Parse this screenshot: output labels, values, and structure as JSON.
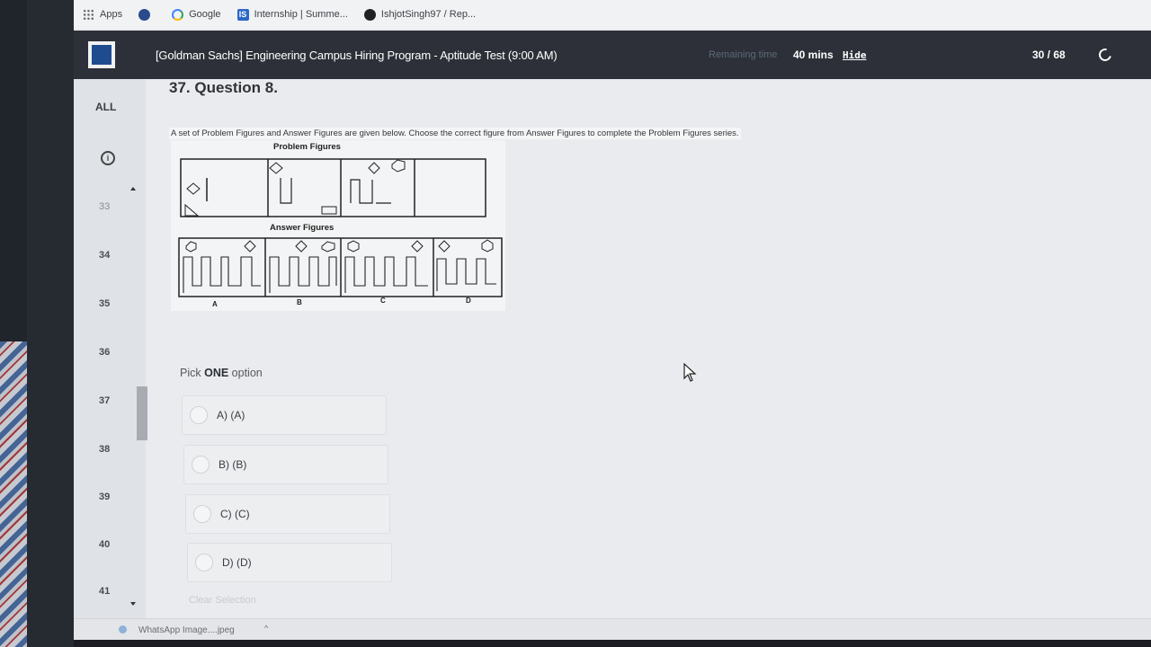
{
  "bookmarks": [
    {
      "label": "Apps",
      "icon": "apps-icon"
    },
    {
      "label": "",
      "icon": "globe-icon"
    },
    {
      "label": "Google",
      "icon": "google-icon"
    },
    {
      "label": "Internship | Summe...",
      "icon": "internshala-icon"
    },
    {
      "label": "IshjotSingh97 / Rep...",
      "icon": "github-icon"
    }
  ],
  "header": {
    "title": "[Goldman Sachs] Engineering Campus Hiring Program - Aptitude Test (9:00 AM)",
    "remaining_label": "Remaining time",
    "remaining_value": "40 mins",
    "hide_label": "Hide",
    "progress": "30 / 68",
    "theme_icon": "moon-icon"
  },
  "nav": {
    "all_label": "ALL",
    "info_icon": "info-icon",
    "numbers": [
      "33",
      "34",
      "35",
      "36",
      "37",
      "38",
      "39",
      "40",
      "41"
    ]
  },
  "question": {
    "title": "37. Question 8.",
    "text": "A set of Problem Figures and Answer Figures are given below. Choose the correct figure from Answer Figures to complete the Problem Figures series.",
    "problem_label": "Problem Figures",
    "answer_label": "Answer Figures",
    "answer_letters": [
      "A",
      "B",
      "C",
      "D"
    ]
  },
  "answer": {
    "pick_prefix": "Pick ",
    "pick_bold": "ONE",
    "pick_suffix": " option",
    "options": [
      "A) (A)",
      "B) (B)",
      "C) (C)",
      "D) (D)"
    ],
    "clear_label": "Clear Selection"
  },
  "downloads": {
    "file_name": "WhatsApp Image....jpeg"
  },
  "colors": {
    "topbar": "#2d3038",
    "brand_logo": "#1f4c8f",
    "page_bg": "#e9ebee"
  }
}
